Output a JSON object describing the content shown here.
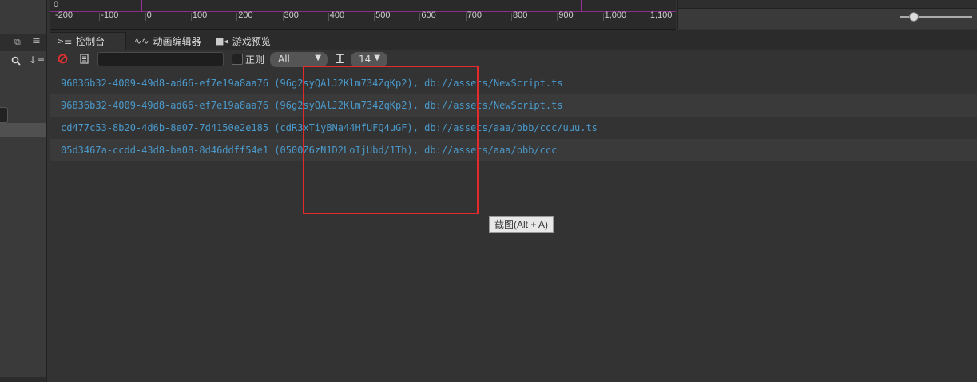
{
  "ruler": {
    "origin_label": "0",
    "ticks": [
      "-200",
      "-100",
      "0",
      "100",
      "200",
      "300",
      "400",
      "500",
      "600",
      "700",
      "800",
      "900",
      "1,000",
      "1,100"
    ]
  },
  "tabs": [
    {
      "label": "控制台",
      "icon": "terminal-icon",
      "active": true
    },
    {
      "label": "动画编辑器",
      "icon": "animation-icon",
      "active": false
    },
    {
      "label": "游戏预览",
      "icon": "camera-icon",
      "active": false
    }
  ],
  "toolbar": {
    "clear_icon": "clear-icon",
    "open_log_icon": "document-icon",
    "filter_value": "",
    "regex_label": "正则",
    "level_value": "All",
    "font_size_value": "14"
  },
  "logs": [
    {
      "text": "96836b32-4009-49d8-ad66-ef7e19a8aa76 (96g2syQAlJ2Klm734ZqKp2), db://assets/NewScript.ts"
    },
    {
      "text": "96836b32-4009-49d8-ad66-ef7e19a8aa76 (96g2syQAlJ2Klm734ZqKp2), db://assets/NewScript.ts"
    },
    {
      "text": "cd477c53-8b20-4d6b-8e07-7d4150e2e185 (cdR3xTiyBNa44HfUFQ4uGF), db://assets/aaa/bbb/ccc/uuu.ts"
    },
    {
      "text": "05d3467a-ccdd-43d8-ba08-8d46ddff54e1 (0500Z6zN1D2LoIjUbd/1Th), db://assets/aaa/bbb/ccc"
    }
  ],
  "tooltip": {
    "text": "截图(Alt + A)"
  },
  "colors": {
    "log_text": "#4a9acc",
    "highlight": "#e22a2a",
    "clear_icon": "#e03030"
  }
}
